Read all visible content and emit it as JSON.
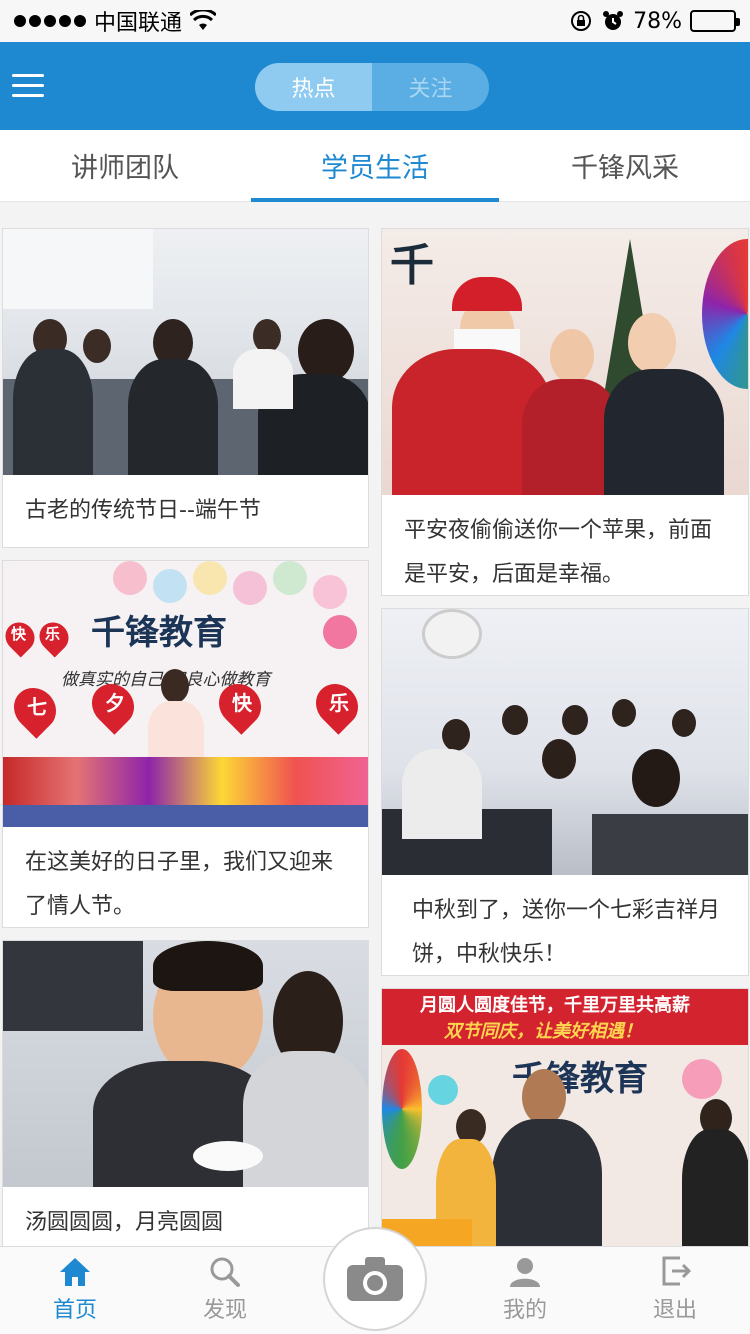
{
  "status_bar": {
    "carrier": "中国联通",
    "battery": "78%",
    "battery_level": 0.78
  },
  "header": {
    "segments": [
      {
        "label": "热点",
        "active": true
      },
      {
        "label": "关注",
        "active": false
      }
    ]
  },
  "tabs": [
    {
      "label": "讲师团队",
      "active": false
    },
    {
      "label": "学员生活",
      "active": true
    },
    {
      "label": "千锋风采",
      "active": false
    }
  ],
  "feed": {
    "cards": [
      {
        "caption": "古老的传统节日--端午节"
      },
      {
        "caption": "平安夜偷偷送你一个苹果，前面是平安，后面是幸福。"
      },
      {
        "caption": "在这美好的日子里，我们又迎来了情人节。",
        "banner_brand": "千锋教育",
        "banner_slogan": "做真实的自己 用良心做教育",
        "hearts": [
          "七",
          "夕",
          "快",
          "乐"
        ],
        "hanging": [
          "快",
          "乐"
        ]
      },
      {
        "caption": "中秋到了，送你一个七彩吉祥月饼，中秋快乐！"
      },
      {
        "caption": "汤圆圆圆，月亮圆圆"
      },
      {
        "caption": "",
        "banner_line1": "月圆人圆度佳节，千里万里共高薪",
        "banner_line2": "双节同庆，让美好相遇！",
        "banner_brand": "千锋教育"
      }
    ]
  },
  "bottom_nav": {
    "items": [
      {
        "label": "首页",
        "icon": "home-icon",
        "active": true
      },
      {
        "label": "发现",
        "icon": "search-icon",
        "active": false
      },
      {
        "label": "",
        "icon": "camera-icon",
        "active": false
      },
      {
        "label": "我的",
        "icon": "user-icon",
        "active": false
      },
      {
        "label": "退出",
        "icon": "logout-icon",
        "active": false
      }
    ]
  },
  "colors": {
    "primary": "#1e88d1",
    "inactive": "#999999"
  }
}
